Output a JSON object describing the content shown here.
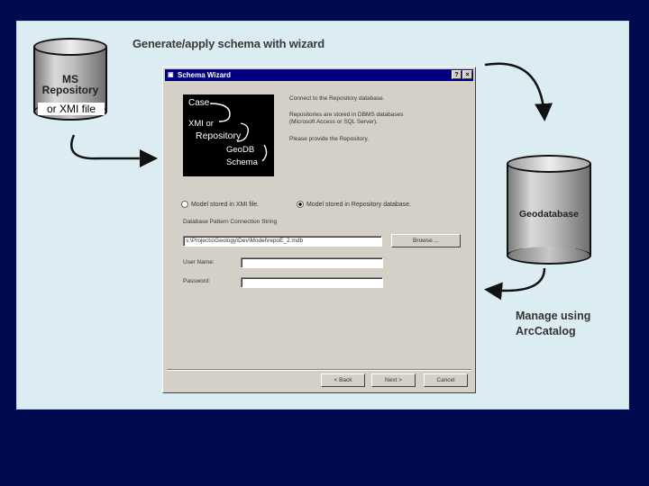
{
  "heading": "Generate/apply schema with wizard",
  "ms_repository": {
    "line1": "MS",
    "line2": "Repository",
    "xmi_label": "or XMI file"
  },
  "geodatabase_label": "Geodatabase",
  "manage": {
    "line1": "Manage using",
    "line2": "ArcCatalog"
  },
  "dialog": {
    "title": "Schema Wizard",
    "help_button": "?",
    "close_button": "×",
    "illustration": {
      "case": "Case",
      "xmi": "XMI or",
      "repository": "Repository",
      "geodb": "GeoDB",
      "schema": "Schema"
    },
    "intro": [
      "Connect to the Repository database.",
      "Repositories are stored in DBMS databases",
      "(Microsoft Access or SQL Server).",
      "Please provide the Repository."
    ],
    "option_xmi": "Model stored in XMI file.",
    "option_repo": "Model stored in Repository database.",
    "connection_label": "Database Pattern Connection String",
    "connection_value": "s:\\Projects\\Geology\\Dev\\Model\\repoE_2.mdb",
    "browse_button": "Browse ...",
    "user_label": "User Name:",
    "password_label": "Password:",
    "user_value": "",
    "password_value": "",
    "back_button": "< Back",
    "next_button": "Next >",
    "cancel_button": "Cancel"
  }
}
